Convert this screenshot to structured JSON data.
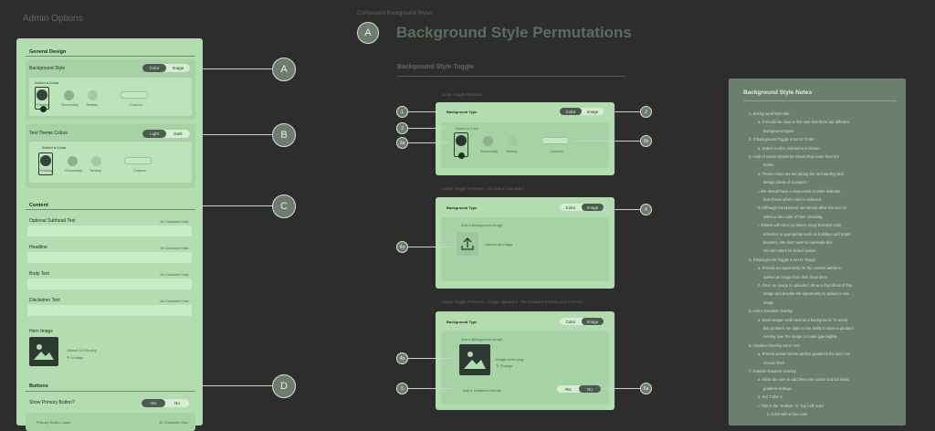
{
  "admin": {
    "title": "Admin Options",
    "general_design": "General Design",
    "bg_style": {
      "label": "Background Style",
      "opt1": "Color",
      "opt2": "Image"
    },
    "select_color": "Select a Color",
    "swatches": [
      "Primary",
      "Secondary",
      "Tertiary"
    ],
    "custom_label": "Custom",
    "text_theme": {
      "label": "Text Theme Colors",
      "opt1": "Light",
      "opt2": "Dark"
    },
    "select_color2": "Select a Color",
    "content": "Content",
    "fields": [
      {
        "label": "Optional Subhead Text",
        "count": "16 Character Max"
      },
      {
        "label": "Headline",
        "count": "16 Character Max"
      },
      {
        "label": "Body Text",
        "count": "16 Character Max"
      },
      {
        "label": "Disclaimer Text",
        "count": "16 Character Max"
      }
    ],
    "hero_image": "Hero Image",
    "img_name": "Default 1234x.png",
    "change": "Change",
    "buttons": "Buttons",
    "show_primary": {
      "label": "Show Primary Button?",
      "opt1": "Yes",
      "opt2": "No"
    },
    "primary_label": "Primary Button Label",
    "primary_count": "16 Character Max"
  },
  "markers": {
    "a": "A",
    "b": "B",
    "c": "C",
    "d": "D"
  },
  "center": {
    "subtitle": "Component Background Styles",
    "badge": "A",
    "title": "Background Style Permutations",
    "section": "Background Style Toggle",
    "caption1": "Color Toggle Selected",
    "caption2": "Image Toggle Selected - No Image Uploaded",
    "caption3": "Image Toggle Selected - Image Uploaded - No Gradient Overlay Not Selected",
    "card_title": "Background Type",
    "opt_color": "Color",
    "opt_image": "Image",
    "add_bg": "Add a Background Image",
    "upload": "Upload an Image",
    "img_file": "Image-name.png",
    "change": "Change",
    "add_gradient": "Add a Gradient Overlay",
    "yes": "Yes",
    "no": "No",
    "n1": "1",
    "n2": "2",
    "n3": "3",
    "n3a": "3a",
    "n3b": "3b",
    "n4": "4",
    "n4a": "4a",
    "n4b": "4b",
    "n5": "5",
    "n5a": "5a"
  },
  "notes": {
    "title": "Background Style Notes",
    "lines": [
      "1.  Background style title",
      "a.  It should be clear to the user that there are different",
      "background types",
      "2.  If Background Toggle is set to 'Color'",
      "a.  Select a color. Submenu is shown",
      "3.  A list of colors should be shown that come from the",
      "theme",
      "a.  These colors are set during the on boarding and",
      "design phase of a project",
      "i.  We should have a clear mock or other indicator",
      "that shows which color is selected",
      "b.  Although not planned, we should allow the user to",
      "select a hex color of their choosing",
      "i.  Tokens will come up where arcpy branded color",
      "schemes is appropriate such as holidays and brand",
      "favorites. We don't want to hardcode this",
      "into set colors for brand names",
      "4.  If Background Toggle is set to 'Image'",
      "a.  Provide an opportunity for the content admin to",
      "upload an image from their local drive",
      "b.  Once an image is uploaded, show a thumbnail of that",
      "image and provide the opportunity to upload a new",
      "image",
      "5.  Add a Gradient Overlay",
      "a.  Most images work best as a Background. To avoid",
      "this problem, we bake in the ability to have a gradient",
      "overlay over the image to make type legible",
      "6.  Gradient Overlay set to Yes",
      "a.  Provide preset theme perfect gradients the user can",
      "choose from",
      "7.  Custom Gradient Overlay",
      "a.  Allow the user to add their own colors and set basic",
      "gradient settings",
      "b.  Set 'Color 1'",
      "i.  This is the 'Outside' or 'Top Left' color",
      "ii.  Color with a hex code"
    ]
  }
}
